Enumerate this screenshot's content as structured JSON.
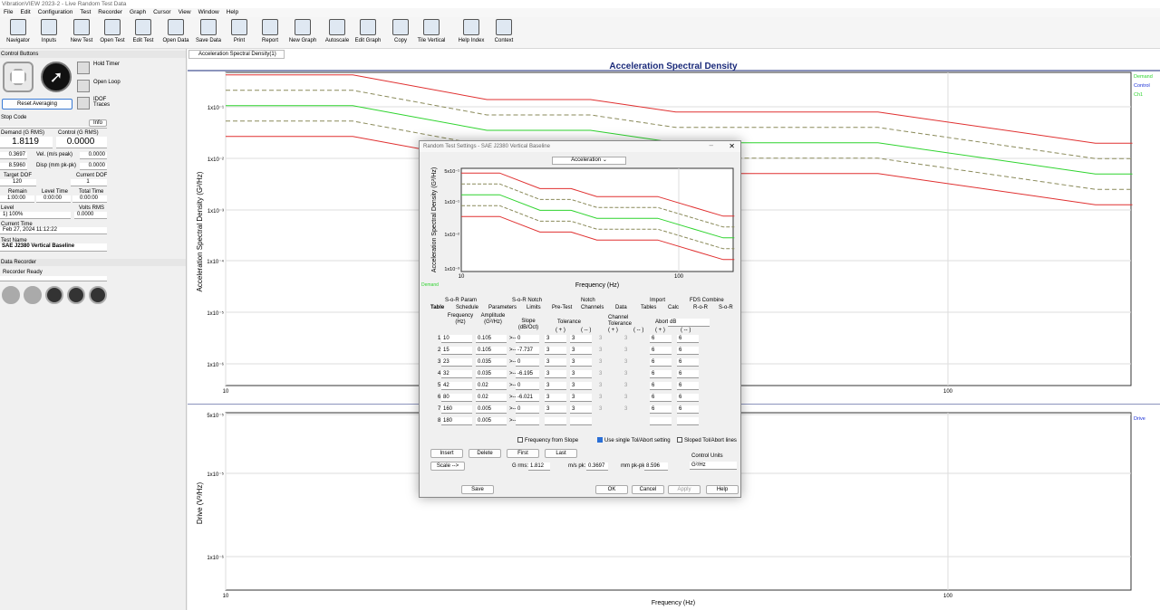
{
  "window": {
    "title": "VibrationVIEW 2023-2 - Live Random Test Data"
  },
  "menu": [
    "File",
    "Edit",
    "Configuration",
    "Test",
    "Recorder",
    "Graph",
    "Cursor",
    "View",
    "Window",
    "Help"
  ],
  "toolbar": [
    {
      "label": "Navigator"
    },
    {
      "label": "Inputs"
    },
    {
      "label": "New Test"
    },
    {
      "label": "Open Test"
    },
    {
      "label": "Edit Test"
    },
    {
      "label": "Open Data"
    },
    {
      "label": "Save Data"
    },
    {
      "label": "Print"
    },
    {
      "label": "Report"
    },
    {
      "label": "New Graph"
    },
    {
      "label": "Autoscale"
    },
    {
      "label": "Edit Graph"
    },
    {
      "label": "Copy"
    },
    {
      "label": "Tile Vertical"
    },
    {
      "label": "Help Index"
    },
    {
      "label": "Context"
    }
  ],
  "control": {
    "section": "Control Buttons",
    "hold_timer": "Hold Timer",
    "open_loop": "Open Loop",
    "idof": "IDOF Traces",
    "reset": "Reset Averaging",
    "stop_code": "Stop Code",
    "info": "Info",
    "demand_label": "Demand (G RMS)",
    "control_label": "Control (G RMS)",
    "demand_val": "1.8119",
    "control_val": "0.0000",
    "v1": "0.3697",
    "vel_label": "Vel. (m/s peak)",
    "vel_val": "0.0000",
    "v2": "8.5960",
    "disp_label": "Disp (mm pk-pk)",
    "disp_val": "0.0000",
    "target_dof_label": "Target DOF",
    "target_dof": "120",
    "current_dof_label": "Current DOF",
    "current_dof": "1",
    "remain_label": "Remain",
    "remain": "1:00:00",
    "level_time_label": "Level Time",
    "level_time": "0:00:00",
    "total_time_label": "Total Time",
    "total_time": "0:00:00",
    "level_label": "Level",
    "level": "1) 100%",
    "volts_label": "Volts RMS",
    "volts": "0.0000",
    "current_time_label": "Current Time",
    "current_time": "Feb 27, 2024 11:12:22",
    "test_name_label": "Test Name",
    "test_name": "SAE J2380 Vertical Baseline"
  },
  "recorder": {
    "section": "Data Recorder",
    "status": "Recorder Ready"
  },
  "tab": "Acceleration Spectral Density(1)",
  "top_graph": {
    "title": "Acceleration Spectral Density",
    "ylabel": "Acceleration Spectral Density (G²/Hz)",
    "xlabel": "Frequency (Hz)",
    "legend": [
      "Demand",
      "Control",
      "Ch1"
    ],
    "yticks": [
      "1x10⁻¹",
      "1x10⁻²",
      "1x10⁻³",
      "1x10⁻⁴",
      "1x10⁻⁵",
      "1x10⁻⁶"
    ],
    "xticks": [
      "10",
      "100"
    ]
  },
  "bottom_graph": {
    "ylabel": "Drive (V²/Hz)",
    "xlabel": "Frequency (Hz)",
    "legend": [
      "Drive"
    ],
    "yticks": [
      "5x10⁻⁵",
      "1x10⁻⁵",
      "1x10⁻⁶"
    ],
    "xticks": [
      "10",
      "100"
    ]
  },
  "dialog": {
    "title": "Random Test Settings - SAE J2380 Vertical Baseline",
    "graph_select": "Acceleration",
    "graph_ylabel": "Acceleration Spectral Density (G²/Hz)",
    "graph_xlabel": "Frequency (Hz)",
    "graph_yticks": [
      "5x10⁻¹",
      "1x10⁻¹",
      "1x10⁻²",
      "1x10⁻³"
    ],
    "graph_xticks": [
      "10",
      "100"
    ],
    "demand_label": "Demand",
    "tabs_row1": [
      "S-o-R Param",
      "S-o-R Notch",
      "Notch",
      "Import",
      "FDS Combine"
    ],
    "tabs_row2": [
      "Table",
      "Schedule",
      "Parameters",
      "Limits",
      "Pre-Test",
      "Channels",
      "Data",
      "Tables",
      "Calc",
      "R-o-R",
      "S-o-R"
    ],
    "col_freq": "Frequency (Hz)",
    "col_amp": "Amplitude (G²/Hz)",
    "col_slope": "Slope (dB/Oct)",
    "col_tol": "Tolerance",
    "col_chan_tol": "Channel Tolerance",
    "col_abort": "Abort",
    "abort_unit": "dB",
    "plus": "( + )",
    "minus": "( -- )",
    "rows": [
      {
        "n": "1",
        "f": "10",
        "a": "0.105",
        "s": "0",
        "tp": "3",
        "tm": "3",
        "gp": "3",
        "gm": "3",
        "ap": "6",
        "am": "6"
      },
      {
        "n": "2",
        "f": "15",
        "a": "0.105",
        "s": "-7.737",
        "tp": "3",
        "tm": "3",
        "gp": "3",
        "gm": "3",
        "ap": "6",
        "am": "6"
      },
      {
        "n": "3",
        "f": "23",
        "a": "0.035",
        "s": "0",
        "tp": "3",
        "tm": "3",
        "gp": "3",
        "gm": "3",
        "ap": "6",
        "am": "6"
      },
      {
        "n": "4",
        "f": "32",
        "a": "0.035",
        "s": "-6.195",
        "tp": "3",
        "tm": "3",
        "gp": "3",
        "gm": "3",
        "ap": "6",
        "am": "6"
      },
      {
        "n": "5",
        "f": "42",
        "a": "0.02",
        "s": "0",
        "tp": "3",
        "tm": "3",
        "gp": "3",
        "gm": "3",
        "ap": "6",
        "am": "6"
      },
      {
        "n": "6",
        "f": "80",
        "a": "0.02",
        "s": "-6.021",
        "tp": "3",
        "tm": "3",
        "gp": "3",
        "gm": "3",
        "ap": "6",
        "am": "6"
      },
      {
        "n": "7",
        "f": "160",
        "a": "0.005",
        "s": "0",
        "tp": "3",
        "tm": "3",
        "gp": "3",
        "gm": "3",
        "ap": "6",
        "am": "6"
      },
      {
        "n": "8",
        "f": "180",
        "a": "0.005",
        "s": "",
        "tp": "",
        "tm": "",
        "gp": "",
        "gm": "",
        "ap": "",
        "am": ""
      }
    ],
    "slope_arrow": ">--",
    "freq_from_slope": "Frequency from Slope",
    "single_tol": "Use single Tol/Abort setting",
    "sloped_tol": "Sloped Tol/Abort lines",
    "insert": "Insert",
    "delete": "Delete",
    "first": "First",
    "last": "Last",
    "scale": "Scale -->",
    "grms_label": "G rms:",
    "grms": "1.812",
    "ms_label": "m/s pk:",
    "ms": "0.3697",
    "mm_label": "mm pk-pk:",
    "mm": "8.596",
    "control_units_label": "Control Units",
    "control_units": "G²/Hz",
    "save": "Save",
    "ok": "OK",
    "cancel": "Cancel",
    "apply": "Apply",
    "help": "Help"
  }
}
